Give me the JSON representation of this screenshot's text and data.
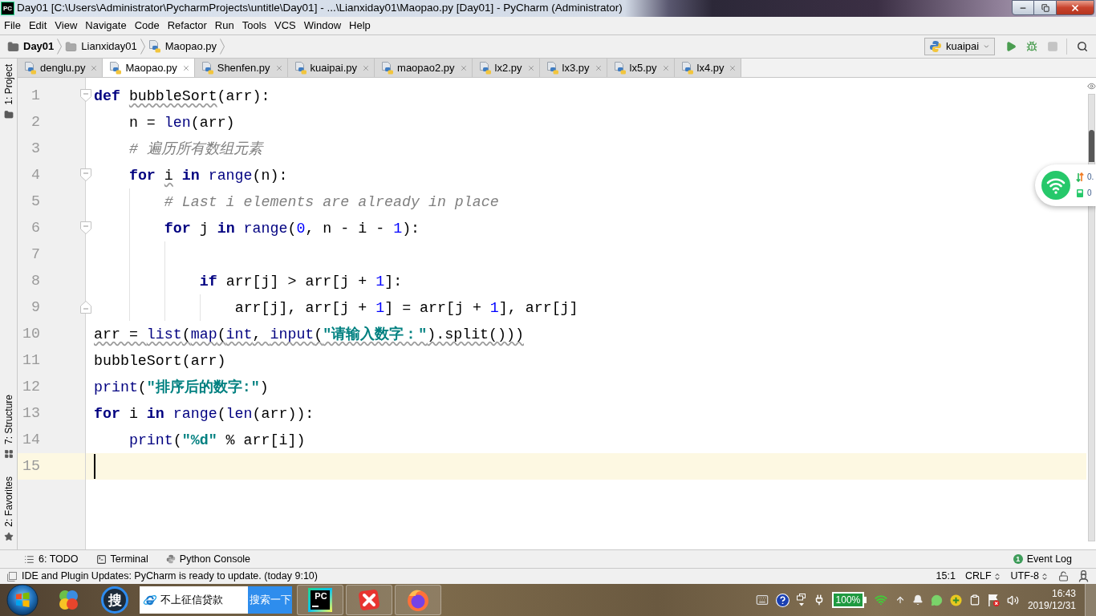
{
  "window": {
    "app_logo": "PC",
    "title": "Day01 [C:\\Users\\Administrator\\PycharmProjects\\untitle\\Day01] - ...\\Lianxiday01\\Maopao.py [Day01] - PyCharm (Administrator)"
  },
  "menu": [
    "File",
    "Edit",
    "View",
    "Navigate",
    "Code",
    "Refactor",
    "Run",
    "Tools",
    "VCS",
    "Window",
    "Help"
  ],
  "breadcrumbs": [
    {
      "kind": "project",
      "label": "Day01"
    },
    {
      "kind": "folder",
      "label": "Lianxiday01"
    },
    {
      "kind": "file",
      "label": "Maopao.py"
    }
  ],
  "run_config": {
    "label": "kuaipai"
  },
  "toolbar": [
    {
      "kind": "run",
      "disabled": false
    },
    {
      "kind": "debug",
      "disabled": false
    },
    {
      "kind": "stop",
      "disabled": true
    },
    {
      "kind": "search",
      "disabled": false
    }
  ],
  "tabs": [
    {
      "label": "denglu.py",
      "selected": false
    },
    {
      "label": "Maopao.py",
      "selected": true
    },
    {
      "label": "Shenfen.py",
      "selected": false
    },
    {
      "label": "kuaipai.py",
      "selected": false
    },
    {
      "label": "maopao2.py",
      "selected": false
    },
    {
      "label": "lx2.py",
      "selected": false
    },
    {
      "label": "lx3.py",
      "selected": false
    },
    {
      "label": "lx5.py",
      "selected": false
    },
    {
      "label": "lx4.py",
      "selected": false
    }
  ],
  "tool_strip": {
    "top": [
      {
        "kind": "project",
        "label": "1: Project"
      }
    ],
    "bottom": [
      {
        "kind": "structure",
        "label": "7: Structure"
      },
      {
        "kind": "favorites",
        "label": "2: Favorites"
      }
    ]
  },
  "editor": {
    "lines": [
      {
        "number": "1",
        "fold_start": true,
        "fold_end": false,
        "current": false,
        "tokens": [
          {
            "kind": "keyword",
            "text": "def ",
            "warning": false
          },
          {
            "kind": "plain",
            "text": "bubbleSort",
            "warning": true
          },
          {
            "kind": "plain",
            "text": "(arr):",
            "warning": false
          }
        ],
        "children": [
          {
            "number": "2",
            "fold_start": false,
            "fold_end": false,
            "current": false,
            "tokens": [
              {
                "kind": "plain",
                "text": "n = ",
                "warning": false
              },
              {
                "kind": "builtin",
                "text": "len",
                "warning": false
              },
              {
                "kind": "plain",
                "text": "(arr)",
                "warning": false
              }
            ]
          },
          {
            "number": "3",
            "fold_start": false,
            "fold_end": false,
            "current": false,
            "tokens": [
              {
                "kind": "comment",
                "text": "# 遍历所有数组元素",
                "warning": false
              }
            ]
          },
          {
            "number": "4",
            "fold_start": true,
            "fold_end": false,
            "current": false,
            "tokens": [
              {
                "kind": "keyword",
                "text": "for ",
                "warning": false
              },
              {
                "kind": "plain",
                "text": "i",
                "warning": true
              },
              {
                "kind": "keyword",
                "text": " in ",
                "warning": false
              },
              {
                "kind": "builtin",
                "text": "range",
                "warning": false
              },
              {
                "kind": "plain",
                "text": "(n):",
                "warning": false
              }
            ],
            "children": [
              {
                "number": "5",
                "fold_start": false,
                "fold_end": false,
                "current": false,
                "tokens": [
                  {
                    "kind": "comment",
                    "text": "# Last i elements are already in place",
                    "warning": false
                  }
                ]
              },
              {
                "number": "6",
                "fold_start": true,
                "fold_end": false,
                "current": false,
                "tokens": [
                  {
                    "kind": "keyword",
                    "text": "for",
                    "warning": false
                  },
                  {
                    "kind": "plain",
                    "text": " j ",
                    "warning": false
                  },
                  {
                    "kind": "keyword",
                    "text": "in ",
                    "warning": false
                  },
                  {
                    "kind": "builtin",
                    "text": "range",
                    "warning": false
                  },
                  {
                    "kind": "plain",
                    "text": "(",
                    "warning": false
                  },
                  {
                    "kind": "number",
                    "text": "0",
                    "warning": false
                  },
                  {
                    "kind": "plain",
                    "text": ", n - i - ",
                    "warning": false
                  },
                  {
                    "kind": "number",
                    "text": "1",
                    "warning": false
                  },
                  {
                    "kind": "plain",
                    "text": "):",
                    "warning": false
                  }
                ],
                "children": [
                  {
                    "number": "7",
                    "fold_start": false,
                    "fold_end": false,
                    "current": false
                  },
                  {
                    "number": "8",
                    "fold_start": false,
                    "fold_end": false,
                    "current": false,
                    "tokens": [
                      {
                        "kind": "keyword",
                        "text": "if",
                        "warning": false
                      },
                      {
                        "kind": "plain",
                        "text": " arr[j] > arr[j + ",
                        "warning": false
                      },
                      {
                        "kind": "number",
                        "text": "1",
                        "warning": false
                      },
                      {
                        "kind": "plain",
                        "text": "]:",
                        "warning": false
                      }
                    ],
                    "children": [
                      {
                        "number": "9",
                        "fold_start": false,
                        "fold_end": true,
                        "current": false,
                        "tokens": [
                          {
                            "kind": "plain",
                            "text": "arr[j], arr[j + ",
                            "warning": false
                          },
                          {
                            "kind": "number",
                            "text": "1",
                            "warning": false
                          },
                          {
                            "kind": "plain",
                            "text": "] = arr[j + ",
                            "warning": false
                          },
                          {
                            "kind": "number",
                            "text": "1",
                            "warning": false
                          },
                          {
                            "kind": "plain",
                            "text": "], arr[j]",
                            "warning": false
                          }
                        ]
                      }
                    ]
                  }
                ]
              }
            ]
          }
        ]
      },
      {
        "number": "10",
        "fold_start": false,
        "fold_end": false,
        "current": false,
        "tokens": [
          {
            "kind": "plain",
            "text": "arr = ",
            "warning": true
          },
          {
            "kind": "builtin",
            "text": "list",
            "warning": true
          },
          {
            "kind": "plain",
            "text": "(",
            "warning": true
          },
          {
            "kind": "builtin",
            "text": "map",
            "warning": true
          },
          {
            "kind": "plain",
            "text": "(",
            "warning": true
          },
          {
            "kind": "builtin",
            "text": "int",
            "warning": true
          },
          {
            "kind": "plain",
            "text": ", ",
            "warning": true
          },
          {
            "kind": "builtin",
            "text": "input",
            "warning": true
          },
          {
            "kind": "plain",
            "text": "(",
            "warning": true
          },
          {
            "kind": "string",
            "text": "\"请输入数字：\"",
            "warning": true
          },
          {
            "kind": "plain",
            "text": ").split()))",
            "warning": true
          }
        ]
      },
      {
        "number": "11",
        "fold_start": false,
        "fold_end": false,
        "current": false,
        "tokens": [
          {
            "kind": "plain",
            "text": "bubbleSort(arr)",
            "warning": false
          }
        ]
      },
      {
        "number": "12",
        "fold_start": false,
        "fold_end": false,
        "current": false,
        "tokens": [
          {
            "kind": "builtin",
            "text": "print",
            "warning": false
          },
          {
            "kind": "plain",
            "text": "(",
            "warning": false
          },
          {
            "kind": "string",
            "text": "\"排序后的数字:\"",
            "warning": false
          },
          {
            "kind": "plain",
            "text": ")",
            "warning": false
          }
        ]
      },
      {
        "number": "13",
        "fold_start": false,
        "fold_end": false,
        "current": false,
        "tokens": [
          {
            "kind": "keyword",
            "text": "for",
            "warning": false
          },
          {
            "kind": "plain",
            "text": " i ",
            "warning": false
          },
          {
            "kind": "keyword",
            "text": "in ",
            "warning": false
          },
          {
            "kind": "builtin",
            "text": "range",
            "warning": false
          },
          {
            "kind": "plain",
            "text": "(",
            "warning": false
          },
          {
            "kind": "builtin",
            "text": "len",
            "warning": false
          },
          {
            "kind": "plain",
            "text": "(arr)):",
            "warning": false
          }
        ],
        "children": [
          {
            "number": "14",
            "fold_start": false,
            "fold_end": false,
            "current": false,
            "tokens": [
              {
                "kind": "builtin",
                "text": "print",
                "warning": false
              },
              {
                "kind": "plain",
                "text": "(",
                "warning": false
              },
              {
                "kind": "string",
                "text": "\"%d\"",
                "warning": false
              },
              {
                "kind": "plain",
                "text": " % arr[i])",
                "warning": false
              }
            ]
          }
        ]
      },
      {
        "number": "15",
        "fold_start": false,
        "fold_end": false,
        "current": true
      }
    ]
  },
  "tool_windows": [
    {
      "kind": "todo",
      "label": "6: TODO"
    },
    {
      "kind": "terminal",
      "label": "Terminal"
    },
    {
      "kind": "console",
      "label": "Python Console"
    }
  ],
  "event_log": {
    "count": "1",
    "label": "Event Log"
  },
  "status_bar": {
    "message": "IDE and Plugin Updates: PyCharm is ready to update. (today 9:10)",
    "position": "15:1",
    "line_separator": "CRLF",
    "encoding": "UTF-8"
  },
  "network_widget": {
    "readings": [
      "0.",
      "0"
    ]
  },
  "taskbar": {
    "search_logo": "搜",
    "search": {
      "value": "不上征信贷款",
      "button": "搜索一下"
    },
    "apps": [
      {
        "kind": "pycharm",
        "logo": "PC"
      },
      {
        "kind": "cross"
      },
      {
        "kind": "fox"
      }
    ],
    "battery": "100%",
    "time": "16:43",
    "date": "2019/12/31"
  }
}
